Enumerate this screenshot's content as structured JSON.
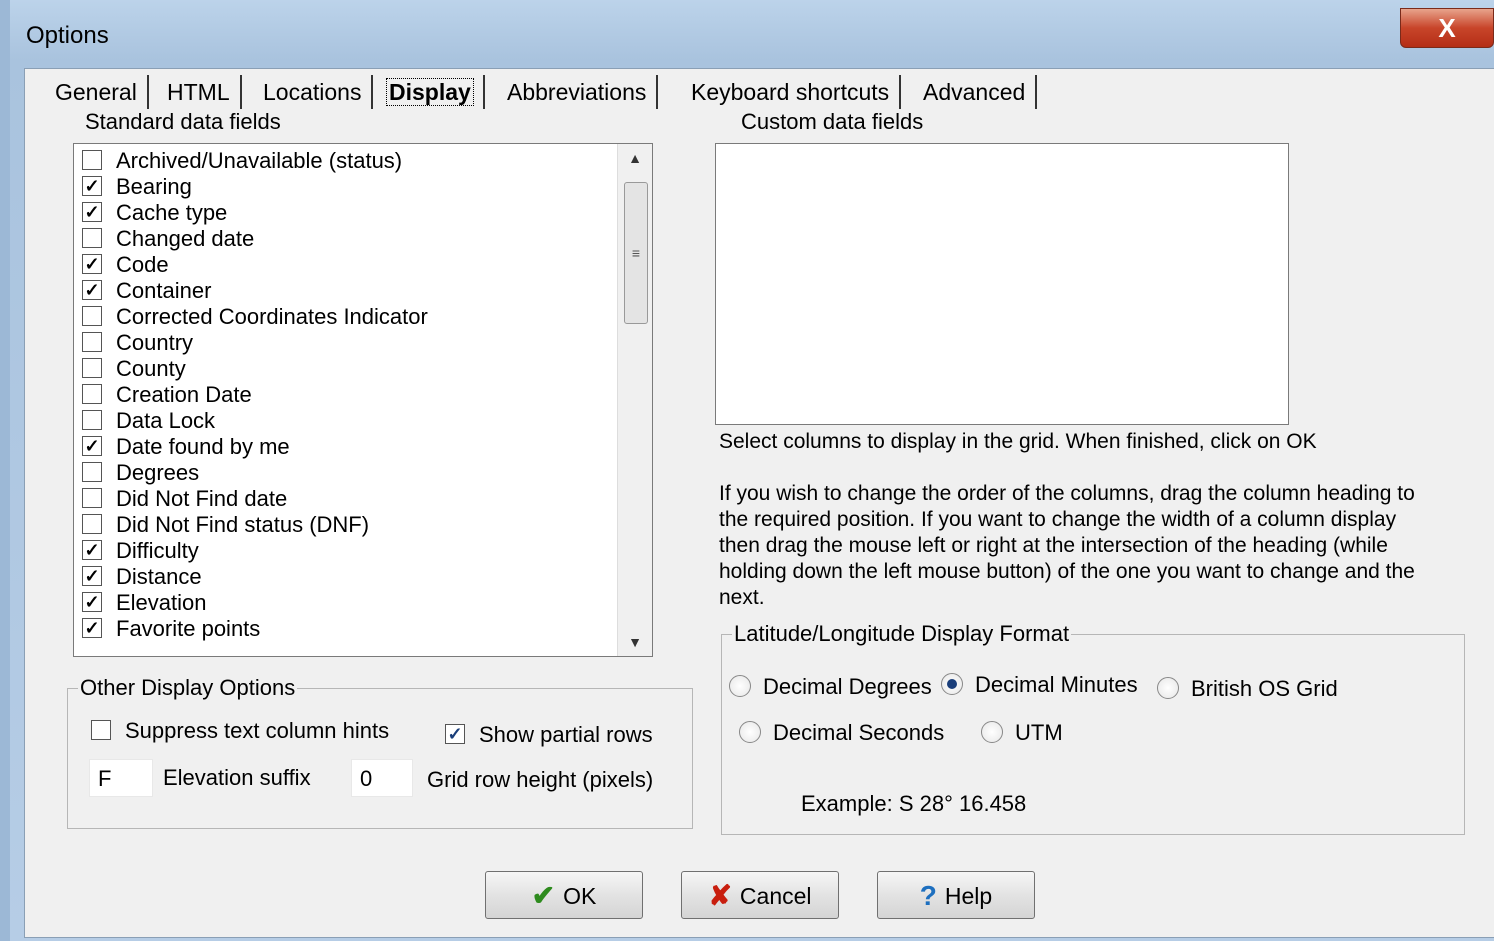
{
  "window": {
    "title": "Options",
    "close_label": "X"
  },
  "tabs": [
    "General",
    "HTML",
    "Locations",
    "Display",
    "Abbreviations",
    "Keyboard shortcuts",
    "Advanced"
  ],
  "active_tab": "Display",
  "standard_fields": {
    "label": "Standard data fields",
    "items": [
      {
        "label": "Archived/Unavailable (status)",
        "checked": false
      },
      {
        "label": "Bearing",
        "checked": true
      },
      {
        "label": "Cache type",
        "checked": true
      },
      {
        "label": "Changed date",
        "checked": false
      },
      {
        "label": "Code",
        "checked": true
      },
      {
        "label": "Container",
        "checked": true
      },
      {
        "label": "Corrected Coordinates Indicator",
        "checked": false
      },
      {
        "label": "Country",
        "checked": false
      },
      {
        "label": "County",
        "checked": false
      },
      {
        "label": "Creation Date",
        "checked": false
      },
      {
        "label": "Data Lock",
        "checked": false
      },
      {
        "label": "Date found by me",
        "checked": true
      },
      {
        "label": "Degrees",
        "checked": false
      },
      {
        "label": "Did Not Find date",
        "checked": false
      },
      {
        "label": "Did Not Find status (DNF)",
        "checked": false
      },
      {
        "label": "Difficulty",
        "checked": true
      },
      {
        "label": "Distance",
        "checked": true
      },
      {
        "label": "Elevation",
        "checked": true
      },
      {
        "label": "Favorite points",
        "checked": true
      }
    ]
  },
  "custom_fields": {
    "label": "Custom data fields"
  },
  "help_text": {
    "line1": "Select columns to display in the grid. When finished, click on OK",
    "paragraph": [
      "If you wish to change the order of the columns, drag the column heading to",
      "the required position. If you want to change the width of a column display",
      "then drag the mouse left or right at the intersection of the heading (while",
      "holding down the left mouse button)  of the one you want to change and the",
      "next."
    ]
  },
  "other_options": {
    "legend": "Other Display Options",
    "suppress_hints": {
      "label": "Suppress text column hints",
      "checked": false
    },
    "show_partial": {
      "label": "Show partial rows",
      "checked": true
    },
    "elevation_suffix": {
      "value": "F",
      "label": "Elevation suffix"
    },
    "row_height": {
      "value": "0",
      "label": "Grid row height (pixels)"
    }
  },
  "latlon": {
    "legend": "Latitude/Longitude Display Format",
    "options": [
      {
        "label": "Decimal Degrees",
        "selected": false
      },
      {
        "label": "Decimal Minutes",
        "selected": true
      },
      {
        "label": "British OS Grid",
        "selected": false
      },
      {
        "label": "Decimal Seconds",
        "selected": false
      },
      {
        "label": "UTM",
        "selected": false
      }
    ],
    "example": "Example: S 28° 16.458"
  },
  "buttons": {
    "ok": {
      "label": "OK",
      "icon": "check-icon",
      "color": "#2e8b1e"
    },
    "cancel": {
      "label": "Cancel",
      "icon": "x-icon",
      "color": "#c81e0e"
    },
    "help": {
      "label": "Help",
      "icon": "question-icon",
      "color": "#1d6fbf"
    }
  }
}
